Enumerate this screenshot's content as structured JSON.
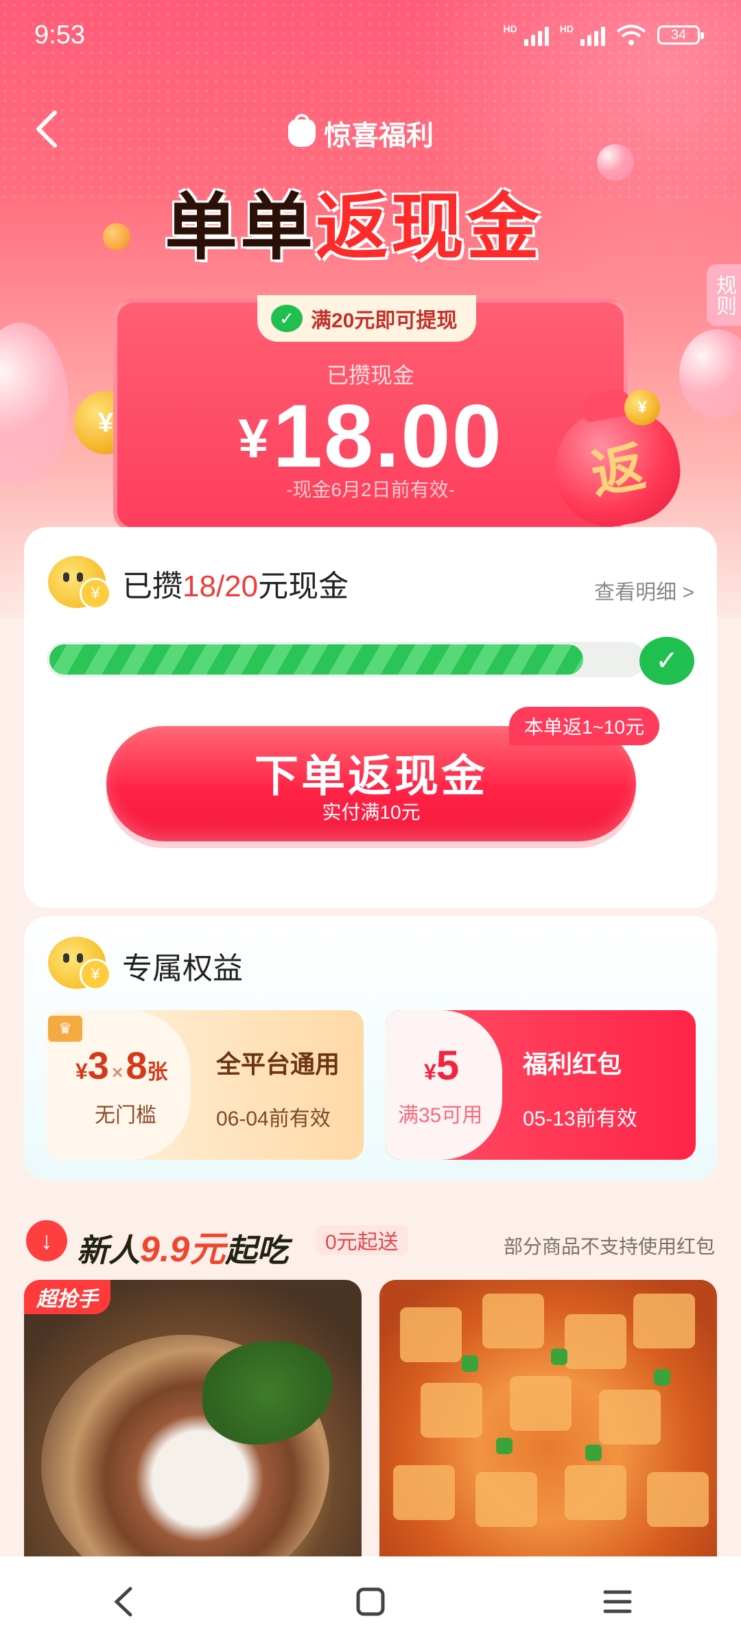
{
  "status": {
    "time": "9:53",
    "battery": "34",
    "hd1": "HD",
    "hd2": "HD"
  },
  "header": {
    "brand": "惊喜福利",
    "title_part1": "单单",
    "title_part2": "返现金",
    "rules": "规则"
  },
  "cash": {
    "withdraw_hint": "满20元即可提现",
    "label": "已攒现金",
    "currency": "¥",
    "amount": "18.00",
    "expire": "-现金6月2日前有效-",
    "bag_char": "返"
  },
  "progress": {
    "title_prefix": "已攒",
    "current": "18/20",
    "title_suffix": "元现金",
    "detail_link": "查看明细 >",
    "fraction": 0.9,
    "return_tag": "本单返1~10元",
    "button_main": "下单返现金",
    "button_sub": "实付满10元"
  },
  "benefits": {
    "title": "专属权益",
    "coupons": [
      {
        "currency": "¥",
        "value": "3",
        "times": "×",
        "count": "8",
        "unit": "张",
        "condition": "无门槛",
        "name": "全平台通用",
        "expire": "06-04前有效"
      },
      {
        "currency": "¥",
        "value": "5",
        "condition": "满35可用",
        "name": "福利红包",
        "expire": "05-13前有效"
      }
    ]
  },
  "promo": {
    "title_prefix": "新人",
    "price": "9.9元",
    "title_suffix": "起吃",
    "tag": "0元起送",
    "note": "部分商品不支持使用红包",
    "chip": "超抢手"
  },
  "colors": {
    "brand_red": "#ff2346",
    "wechat_green": "#1fc04f",
    "accent_pink": "#ff5c78"
  }
}
